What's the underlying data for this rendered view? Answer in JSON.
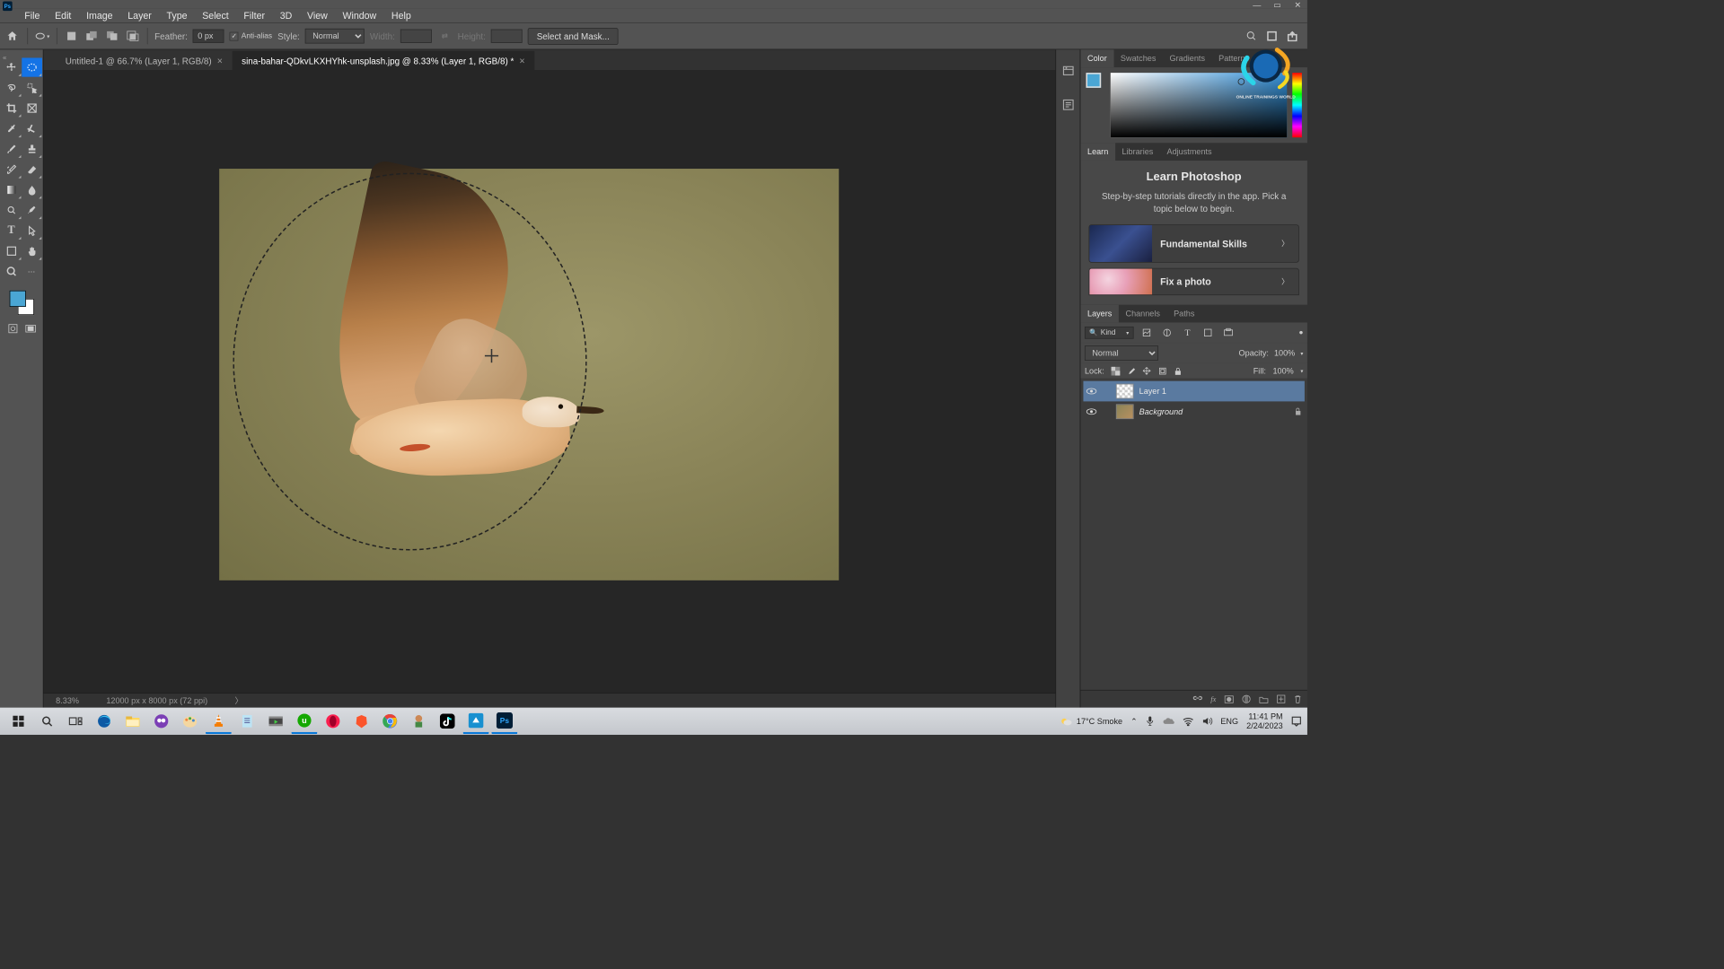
{
  "menubar": [
    "File",
    "Edit",
    "Image",
    "Layer",
    "Type",
    "Select",
    "Filter",
    "3D",
    "View",
    "Window",
    "Help"
  ],
  "options": {
    "feather_label": "Feather:",
    "feather_value": "0 px",
    "antialias": "Anti-alias",
    "style_label": "Style:",
    "style_value": "Normal",
    "width_label": "Width:",
    "height_label": "Height:",
    "select_mask": "Select and Mask..."
  },
  "tabs": [
    {
      "label": "Untitled-1 @ 66.7% (Layer 1, RGB/8)",
      "active": false
    },
    {
      "label": "sina-bahar-QDkvLKXHYhk-unsplash.jpg @ 8.33% (Layer 1, RGB/8) *",
      "active": true
    }
  ],
  "status": {
    "zoom": "8.33%",
    "dims": "12000 px x 8000 px (72 ppi)"
  },
  "panels": {
    "color_tabs": [
      "Color",
      "Swatches",
      "Gradients",
      "Patterns"
    ],
    "learn_tabs": [
      "Learn",
      "Libraries",
      "Adjustments"
    ],
    "learn": {
      "title": "Learn Photoshop",
      "desc": "Step-by-step tutorials directly in the app. Pick a topic below to begin.",
      "items": [
        "Fundamental Skills",
        "Fix a photo"
      ]
    },
    "layers_tabs": [
      "Layers",
      "Channels",
      "Paths"
    ],
    "layers": {
      "kind": "Kind",
      "blend": "Normal",
      "opacity_label": "Opacity:",
      "opacity": "100%",
      "lock_label": "Lock:",
      "fill_label": "Fill:",
      "fill": "100%",
      "items": [
        {
          "name": "Layer 1",
          "selected": true,
          "italic": false
        },
        {
          "name": "Background",
          "selected": false,
          "italic": true,
          "locked": true
        }
      ]
    }
  },
  "otw_label": "ONLINE TRAININGS WORLD",
  "taskbar": {
    "weather": "17°C  Smoke",
    "lang": "ENG",
    "time": "11:41 PM",
    "date": "2/24/2023"
  }
}
